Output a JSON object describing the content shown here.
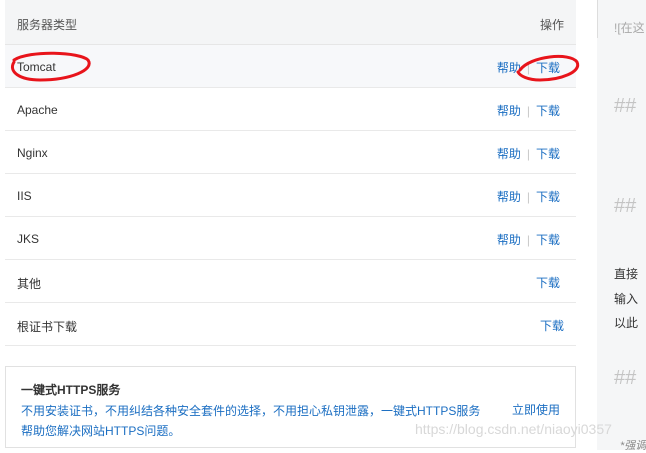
{
  "table": {
    "col_type": "服务器类型",
    "col_action": "操作",
    "rows": [
      {
        "name": "Tomcat",
        "help": "帮助",
        "download": "下载"
      },
      {
        "name": "Apache",
        "help": "帮助",
        "download": "下载"
      },
      {
        "name": "Nginx",
        "help": "帮助",
        "download": "下载"
      },
      {
        "name": "IIS",
        "help": "帮助",
        "download": "下载"
      },
      {
        "name": "JKS",
        "help": "帮助",
        "download": "下载"
      },
      {
        "name": "其他",
        "download": "下载"
      },
      {
        "name": "根证书下载",
        "download": "下载"
      }
    ]
  },
  "promo": {
    "title": "一键式HTTPS服务",
    "desc": "不用安装证书，不用纠结各种安全套件的选择，不用担心私钥泄露，一键式HTTPS服务帮助您解决网站HTTPS问题。",
    "action": "立即使用"
  },
  "side": {
    "top_text": "![在这",
    "h1": "##",
    "h2": "##",
    "line1": "直接",
    "line2": "输入",
    "line3": "以此",
    "h3": "##",
    "bottom": "*强调"
  },
  "watermark": "https://blog.csdn.net/niaoyi0357",
  "colors": {
    "link": "#1b6ec2",
    "annotation": "#e8141b"
  }
}
